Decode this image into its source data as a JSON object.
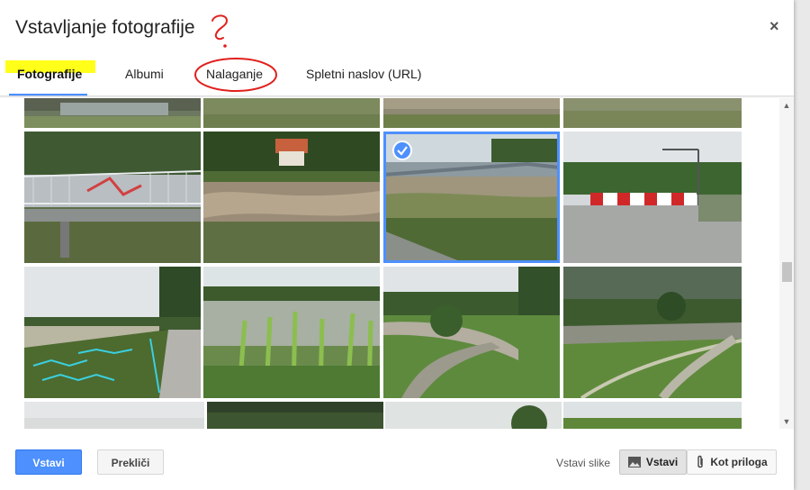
{
  "dialog": {
    "title": "Vstavljanje fotografije",
    "close_label": "×"
  },
  "tabs": [
    {
      "label": "Fotografije",
      "active": true
    },
    {
      "label": "Albumi",
      "active": false
    },
    {
      "label": "Nalaganje",
      "active": false
    },
    {
      "label": "Spletni naslov (URL)",
      "active": false
    }
  ],
  "annotations": {
    "question_mark": "?",
    "highlight_color": "#ffff00",
    "circle_color": "#e0201d"
  },
  "photos": [
    {
      "name": "flooded-riverbank-top-left",
      "selected": false
    },
    {
      "name": "grassy-field-top",
      "selected": false
    },
    {
      "name": "muddy-path-top",
      "selected": false
    },
    {
      "name": "wet-grass-top-right",
      "selected": false
    },
    {
      "name": "damaged-bridge-railing",
      "selected": false
    },
    {
      "name": "flooding-river-houses",
      "selected": false
    },
    {
      "name": "bridge-over-river",
      "selected": true
    },
    {
      "name": "closed-bridge-barrier",
      "selected": false
    },
    {
      "name": "flooded-meadow-river",
      "selected": false
    },
    {
      "name": "flooded-corn-field",
      "selected": false
    },
    {
      "name": "flooded-stream-tree",
      "selected": false
    },
    {
      "name": "flooded-field-path",
      "selected": false
    },
    {
      "name": "foggy-trees-bottom-left",
      "selected": false
    },
    {
      "name": "dark-forest-bottom",
      "selected": false
    },
    {
      "name": "trees-bottom",
      "selected": false
    },
    {
      "name": "field-bottom-right",
      "selected": false
    }
  ],
  "footer": {
    "insert_label": "Vstavi",
    "cancel_label": "Prekliči",
    "insert_images_label": "Vstavi slike",
    "insert_toggle_label": "Vstavi",
    "attachment_label": "Kot priloga"
  },
  "colors": {
    "accent": "#4d90fe",
    "text": "#222222"
  }
}
